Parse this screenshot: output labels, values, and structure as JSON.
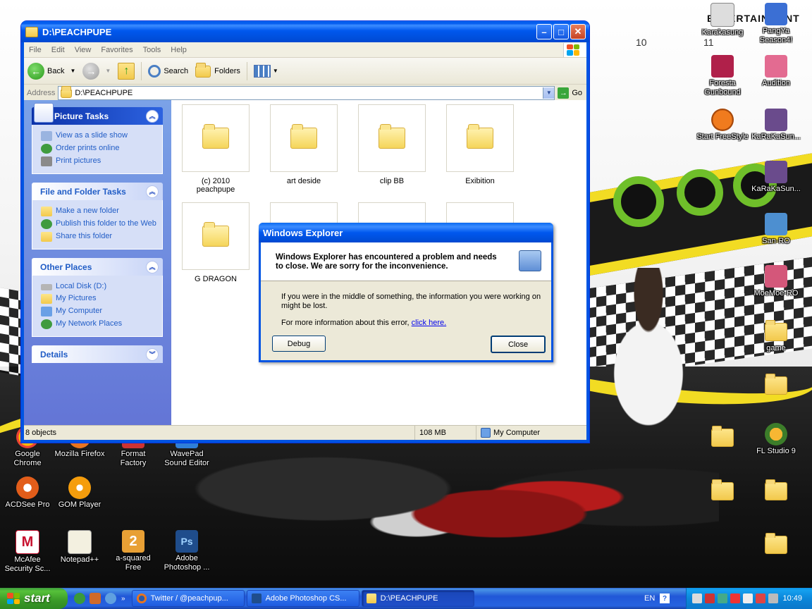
{
  "window": {
    "title": "D:\\PEACHPUPE",
    "menu": [
      "File",
      "Edit",
      "View",
      "Favorites",
      "Tools",
      "Help"
    ],
    "toolbar": {
      "back": "Back",
      "search": "Search",
      "folders": "Folders"
    },
    "address_label": "Address",
    "address_value": "D:\\PEACHPUPE",
    "go_label": "Go"
  },
  "tasks": {
    "picture": {
      "title": "Picture Tasks",
      "items": [
        "View as a slide show",
        "Order prints online",
        "Print pictures"
      ]
    },
    "file_folder": {
      "title": "File and Folder Tasks",
      "items": [
        "Make a new folder",
        "Publish this folder to the Web",
        "Share this folder"
      ]
    },
    "other": {
      "title": "Other Places",
      "items": [
        "Local Disk (D:)",
        "My Pictures",
        "My Computer",
        "My Network Places"
      ]
    },
    "details": {
      "title": "Details"
    }
  },
  "files": [
    "(c) 2010 peachpupe",
    "art deside",
    "clip BB",
    "Exibition",
    "G DRAGON"
  ],
  "status": {
    "objects": "8 objects",
    "size": "108 MB",
    "location": "My Computer"
  },
  "dialog": {
    "title": "Windows Explorer",
    "message": "Windows Explorer has encountered a problem and needs to close.  We are sorry for the inconvenience.",
    "info": "If you were in the middle of something, the information you were working on might be lost.",
    "more_info": "For more information about this error, ",
    "link": "click here.",
    "debug": "Debug",
    "close": "Close"
  },
  "desktop": {
    "logo": "ENTERTAINMENT",
    "icons_left": [
      "Google Chrome",
      "Mozilla Firefox",
      "Format Factory",
      "WavePad Sound Editor",
      "ACDSee Pro",
      "GOM Player",
      "McAfee Security Sc...",
      "Notepad++",
      "a-squared Free",
      "Adobe Photoshop ..."
    ],
    "icons_right": [
      "Karakasung",
      "PangYa Season4!",
      "Foresta Gunbound",
      "Audition",
      "Start FreeStyle",
      "KaRaKaSun...",
      "KaRaKaSun...",
      "San-RO",
      "MoeMoe-RO",
      "game",
      "FL Studio 9"
    ]
  },
  "taskbar": {
    "start": "start",
    "tasks": [
      "Twitter / @peachpup...",
      "Adobe Photoshop CS...",
      "D:\\PEACHPUPE"
    ],
    "lang": "EN",
    "clock": "10:49"
  },
  "colors": {
    "xp_blue": "#0054e3",
    "task_pane": "#7ba2e7",
    "start_green": "#3a9a27",
    "link": "#215dc6"
  }
}
